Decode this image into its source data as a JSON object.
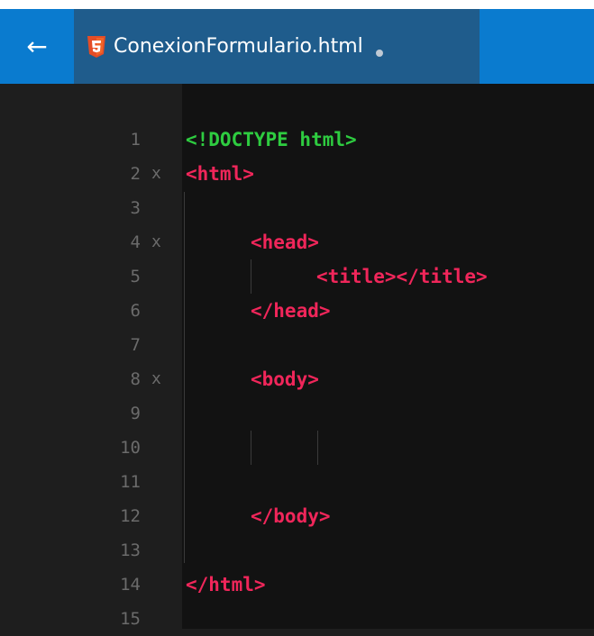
{
  "window": {
    "back_icon": "arrow-left-icon",
    "tab": {
      "title": "ConexionFormulario.html",
      "file_icon": "html5-icon",
      "modified_indicator": "dot-icon"
    }
  },
  "colors": {
    "title_bar": "#0a7bcf",
    "tab_active": "#1f5c8c",
    "editor_bg": "#121212",
    "gutter_bg": "#1e1e1e",
    "line_number": "#6b6b6b",
    "doctype": "#2ecc40",
    "tag": "#f0265a",
    "html5_icon": "#e44d26"
  },
  "editor": {
    "lines": [
      {
        "number": "1",
        "fold": "",
        "code": "<!DOCTYPE html>"
      },
      {
        "number": "2",
        "fold": "x",
        "code": "<html>"
      },
      {
        "number": "3",
        "fold": "",
        "code": ""
      },
      {
        "number": "4",
        "fold": "x",
        "code": "<head>"
      },
      {
        "number": "5",
        "fold": "",
        "code": "<title></title>"
      },
      {
        "number": "6",
        "fold": "",
        "code": "</head>"
      },
      {
        "number": "7",
        "fold": "",
        "code": ""
      },
      {
        "number": "8",
        "fold": "x",
        "code": "<body>"
      },
      {
        "number": "9",
        "fold": "",
        "code": ""
      },
      {
        "number": "10",
        "fold": "",
        "code": ""
      },
      {
        "number": "11",
        "fold": "",
        "code": ""
      },
      {
        "number": "12",
        "fold": "",
        "code": "</body>"
      },
      {
        "number": "13",
        "fold": "",
        "code": ""
      },
      {
        "number": "14",
        "fold": "",
        "code": "</html>"
      },
      {
        "number": "15",
        "fold": "",
        "code": ""
      }
    ]
  }
}
